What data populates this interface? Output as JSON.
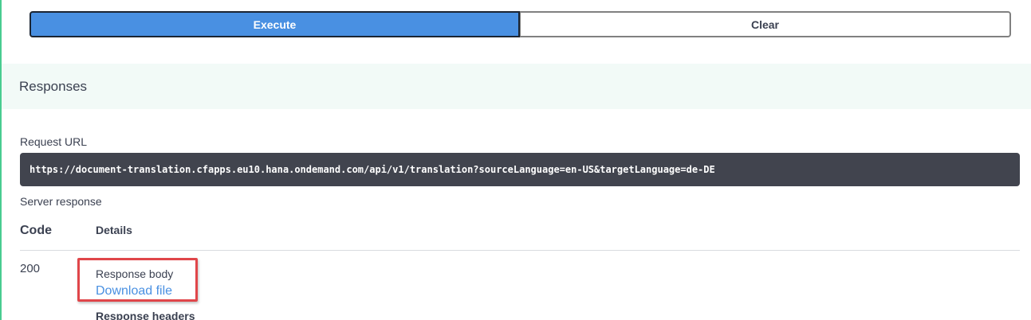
{
  "actions": {
    "execute_label": "Execute",
    "clear_label": "Clear"
  },
  "responses": {
    "title": "Responses",
    "request_url_label": "Request URL",
    "request_url": "https://document-translation.cfapps.eu10.hana.ondemand.com/api/v1/translation?sourceLanguage=en-US&targetLanguage=de-DE",
    "server_response_label": "Server response",
    "columns": {
      "code": "Code",
      "details": "Details"
    },
    "rows": [
      {
        "code": "200",
        "response_body_label": "Response body",
        "download_link": "Download file",
        "response_headers_label": "Response headers"
      }
    ]
  },
  "colors": {
    "accent": "#4990e2",
    "highlight": "#e0464a",
    "url_box": "#41444e",
    "responses_bg": "#f2faf7"
  }
}
